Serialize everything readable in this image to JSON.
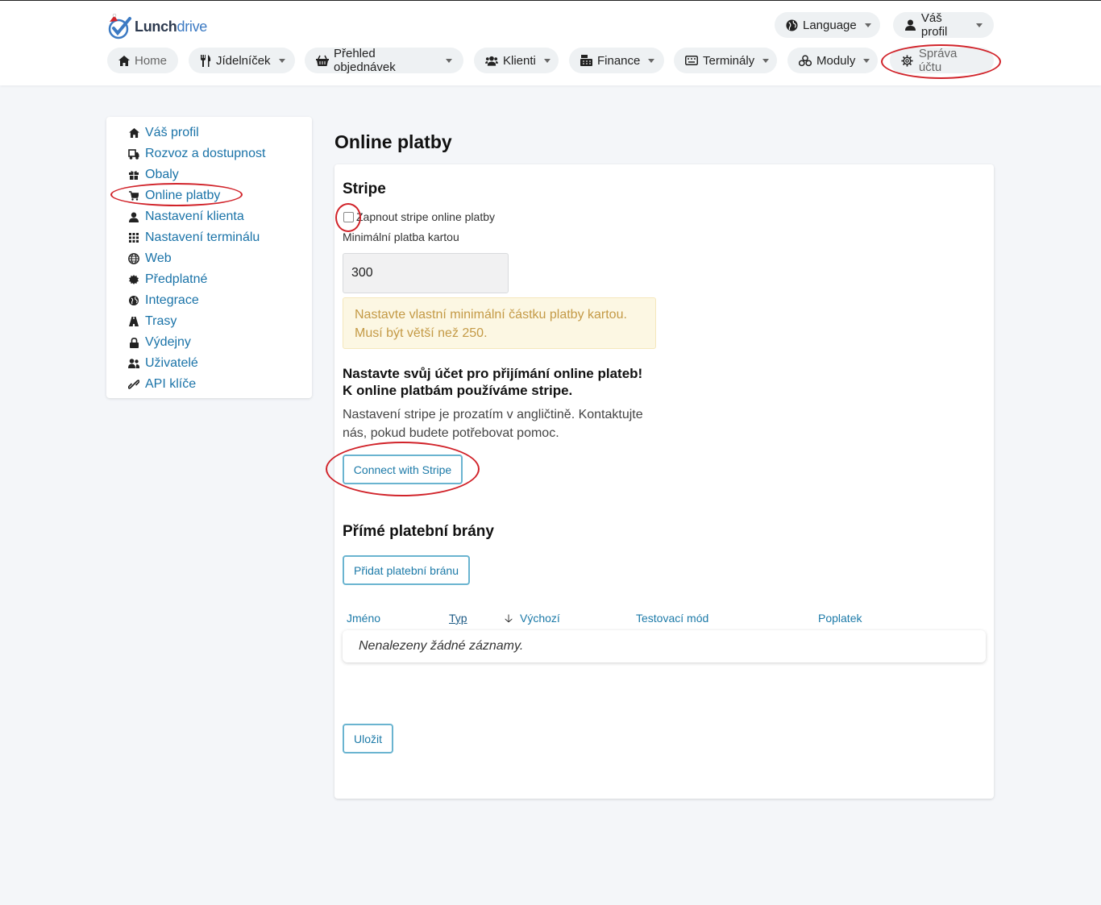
{
  "brand": {
    "name_a": "Lunch",
    "name_b": "drive"
  },
  "top_nav": {
    "language": "Language",
    "profile": "Váš profil",
    "items": [
      {
        "label": "Home"
      },
      {
        "label": "Jídelníček"
      },
      {
        "label": "Přehled objednávek"
      },
      {
        "label": "Klienti"
      },
      {
        "label": "Finance"
      },
      {
        "label": "Terminály"
      },
      {
        "label": "Moduly"
      },
      {
        "label": "Správa účtu"
      }
    ]
  },
  "sidebar": {
    "items": [
      {
        "label": "Váš profil",
        "icon": "home-icon"
      },
      {
        "label": "Rozvoz a dostupnost",
        "icon": "delivery-icon"
      },
      {
        "label": "Obaly",
        "icon": "gift-icon"
      },
      {
        "label": "Online platby",
        "icon": "cart-icon"
      },
      {
        "label": "Nastavení klienta",
        "icon": "user-icon"
      },
      {
        "label": "Nastavení terminálu",
        "icon": "grid-icon"
      },
      {
        "label": "Web",
        "icon": "globe-icon"
      },
      {
        "label": "Předplatné",
        "icon": "certificate-icon"
      },
      {
        "label": "Integrace",
        "icon": "globe-small-icon"
      },
      {
        "label": "Trasy",
        "icon": "road-icon"
      },
      {
        "label": "Výdejny",
        "icon": "lock-icon"
      },
      {
        "label": "Uživatelé",
        "icon": "users-icon"
      },
      {
        "label": "API klíče",
        "icon": "link-icon"
      }
    ]
  },
  "page": {
    "title": "Online platby"
  },
  "stripe": {
    "heading": "Stripe",
    "enable_label": "Zapnout stripe online platby",
    "enabled": false,
    "min_label": "Minimální platba kartou",
    "min_value": "300",
    "warning": "Nastavte vlastní minimální částku platby kartou. Musí být větší než 250.",
    "setup_heading_1": "Nastavte svůj účet pro přijímání online plateb!",
    "setup_heading_2": "K online platbám používáme stripe.",
    "setup_text": "Nastavení stripe je prozatím v angličtině. Kontaktujte nás, pokud budete potřebovat pomoc.",
    "connect_button": "Connect with Stripe"
  },
  "gateways": {
    "heading": "Přímé platební brány",
    "add_button": "Přidat platební bránu",
    "columns": [
      "Jméno",
      "Typ",
      "Výchozí",
      "Testovací mód",
      "Poplatek"
    ],
    "empty": "Nenalezeny žádné záznamy."
  },
  "save_button": "Uložit",
  "colors": {
    "link": "#1a73a8",
    "annotation": "#d1232a",
    "warning_bg": "#fcf7e3",
    "warning_text": "#c49a46"
  }
}
